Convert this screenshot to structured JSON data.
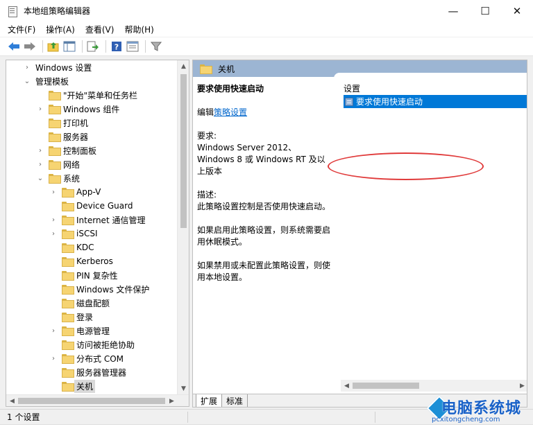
{
  "window": {
    "title": "本地组策略编辑器",
    "controls": {
      "minimize": "—",
      "maximize": "☐",
      "close": "✕"
    }
  },
  "menu": [
    "文件(F)",
    "操作(A)",
    "查看(V)",
    "帮助(H)"
  ],
  "toolbar": [
    "back-icon",
    "forward-icon",
    "up-folder-icon",
    "show-tree-icon",
    "export-icon",
    "help-icon",
    "properties-icon",
    "filter-icon"
  ],
  "tree": {
    "items": [
      {
        "label": "Windows 设置",
        "expander": "›"
      },
      {
        "label": "管理模板",
        "expander": "⌄"
      },
      {
        "label": "\"开始\"菜单和任务栏",
        "expander": ""
      },
      {
        "label": "Windows 组件",
        "expander": "›"
      },
      {
        "label": "打印机",
        "expander": ""
      },
      {
        "label": "服务器",
        "expander": ""
      },
      {
        "label": "控制面板",
        "expander": "›"
      },
      {
        "label": "网络",
        "expander": "›"
      },
      {
        "label": "系统",
        "expander": "⌄"
      },
      {
        "label": "App-V",
        "expander": "›"
      },
      {
        "label": "Device Guard",
        "expander": ""
      },
      {
        "label": "Internet 通信管理",
        "expander": "›"
      },
      {
        "label": "iSCSI",
        "expander": "›"
      },
      {
        "label": "KDC",
        "expander": ""
      },
      {
        "label": "Kerberos",
        "expander": ""
      },
      {
        "label": "PIN 复杂性",
        "expander": ""
      },
      {
        "label": "Windows 文件保护",
        "expander": ""
      },
      {
        "label": "磁盘配额",
        "expander": ""
      },
      {
        "label": "登录",
        "expander": ""
      },
      {
        "label": "电源管理",
        "expander": "›"
      },
      {
        "label": "访问被拒绝协助",
        "expander": ""
      },
      {
        "label": "分布式 COM",
        "expander": "›"
      },
      {
        "label": "服务器管理器",
        "expander": ""
      },
      {
        "label": "关机",
        "expander": ""
      }
    ]
  },
  "right_pane": {
    "header": "关机",
    "description": {
      "title": "要求使用快速启动",
      "edit_prefix": "编辑",
      "edit_link": "策略设置",
      "requirements_label": "要求:",
      "requirements_text": "Windows Server 2012、Windows 8 或 Windows RT 及以上版本",
      "desc_label": "描述:",
      "desc_text": "此策略设置控制是否使用快速启动。",
      "enabled_text": "如果启用此策略设置，则系统需要启用休眠模式。",
      "disabled_text": "如果禁用或未配置此策略设置，则使用本地设置。"
    },
    "list_header": "设置",
    "selected_setting": "要求使用快速启动",
    "tabs": [
      "扩展",
      "标准"
    ]
  },
  "status": {
    "text": "1 个设置"
  },
  "watermark": {
    "title": "电脑系统城",
    "url": "pcxitongcheng.com"
  },
  "colors": {
    "selection": "#0078d7",
    "header_bar": "#9cb5d3",
    "highlight_ring": "#e03a3a"
  }
}
